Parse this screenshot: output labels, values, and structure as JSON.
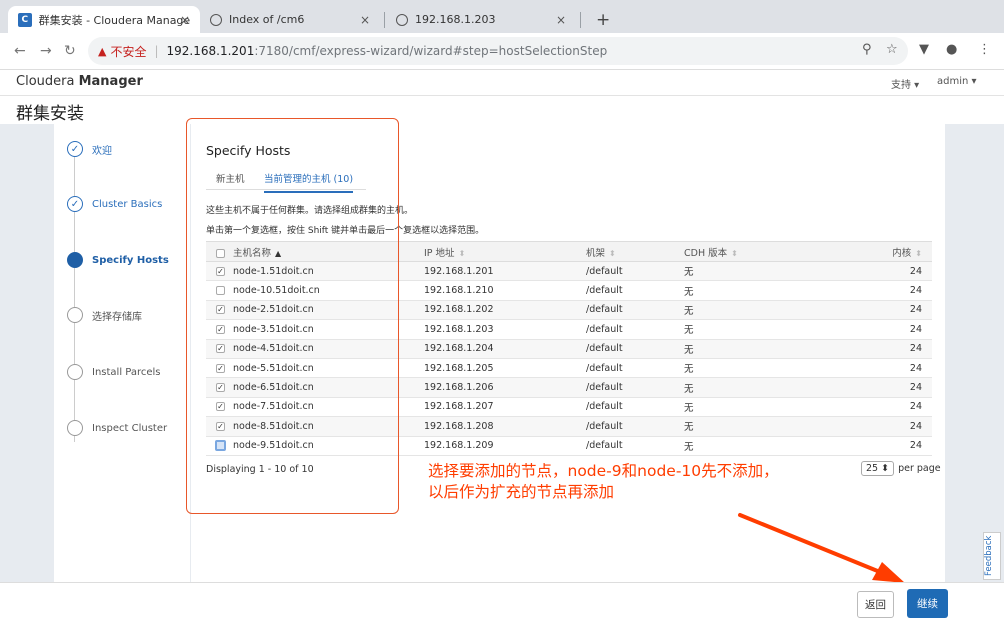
{
  "browser": {
    "tabs": [
      {
        "title": "群集安装 - Cloudera Manager",
        "active": true
      },
      {
        "title": "Index of /cm6",
        "active": false
      },
      {
        "title": "192.168.1.203",
        "active": false
      }
    ],
    "close_glyph": "×",
    "new_tab": "+",
    "security_label": "不安全",
    "url_host": "192.168.1.201",
    "url_path": ":7180/cmf/express-wizard/wizard#step=hostSelectionStep"
  },
  "header": {
    "brand_prefix": "Cloudera",
    "brand_suffix": "Manager",
    "support_menu": "支持 ▾",
    "user_menu": "admin ▾"
  },
  "page_title": "群集安装",
  "steps": [
    {
      "label": "欢迎",
      "state": "done"
    },
    {
      "label": "Cluster Basics",
      "state": "done"
    },
    {
      "label": "Specify Hosts",
      "state": "current"
    },
    {
      "label": "选择存储库",
      "state": "todo"
    },
    {
      "label": "Install Parcels",
      "state": "todo"
    },
    {
      "label": "Inspect Cluster",
      "state": "todo"
    }
  ],
  "main": {
    "section_title": "Specify Hosts",
    "tabs": [
      {
        "label": "新主机",
        "active": false
      },
      {
        "label": "当前管理的主机 (10)",
        "active": true
      }
    ],
    "note1": "这些主机不属于任何群集。请选择组成群集的主机。",
    "note2": "单击第一个复选框，按住 Shift 键并单击最后一个复选框以选择范围。",
    "table": {
      "columns": [
        "主机名称",
        "IP 地址",
        "机架",
        "CDH 版本",
        "内核"
      ],
      "rows": [
        {
          "checked": true,
          "host": "node-1.51doit.cn",
          "ip": "192.168.1.201",
          "rack": "/default",
          "cdh": "无",
          "cores": "24"
        },
        {
          "checked": false,
          "host": "node-10.51doit.cn",
          "ip": "192.168.1.210",
          "rack": "/default",
          "cdh": "无",
          "cores": "24"
        },
        {
          "checked": true,
          "host": "node-2.51doit.cn",
          "ip": "192.168.1.202",
          "rack": "/default",
          "cdh": "无",
          "cores": "24"
        },
        {
          "checked": true,
          "host": "node-3.51doit.cn",
          "ip": "192.168.1.203",
          "rack": "/default",
          "cdh": "无",
          "cores": "24"
        },
        {
          "checked": true,
          "host": "node-4.51doit.cn",
          "ip": "192.168.1.204",
          "rack": "/default",
          "cdh": "无",
          "cores": "24"
        },
        {
          "checked": true,
          "host": "node-5.51doit.cn",
          "ip": "192.168.1.205",
          "rack": "/default",
          "cdh": "无",
          "cores": "24"
        },
        {
          "checked": true,
          "host": "node-6.51doit.cn",
          "ip": "192.168.1.206",
          "rack": "/default",
          "cdh": "无",
          "cores": "24"
        },
        {
          "checked": true,
          "host": "node-7.51doit.cn",
          "ip": "192.168.1.207",
          "rack": "/default",
          "cdh": "无",
          "cores": "24"
        },
        {
          "checked": true,
          "host": "node-8.51doit.cn",
          "ip": "192.168.1.208",
          "rack": "/default",
          "cdh": "无",
          "cores": "24"
        },
        {
          "checked": false,
          "focus": true,
          "host": "node-9.51doit.cn",
          "ip": "192.168.1.209",
          "rack": "/default",
          "cdh": "无",
          "cores": "24"
        }
      ]
    },
    "display_count": "Displaying 1 - 10 of 10",
    "per_page_value": "25 ⬍",
    "per_page_label": "per page"
  },
  "annotation": {
    "line1": "选择要添加的节点，node-9和node-10先不添加，",
    "line2": "以后作为扩充的节点再添加",
    "color": "#ff3d00"
  },
  "feedback": "Feedback",
  "footer": {
    "back": "返回",
    "next": "继续"
  }
}
